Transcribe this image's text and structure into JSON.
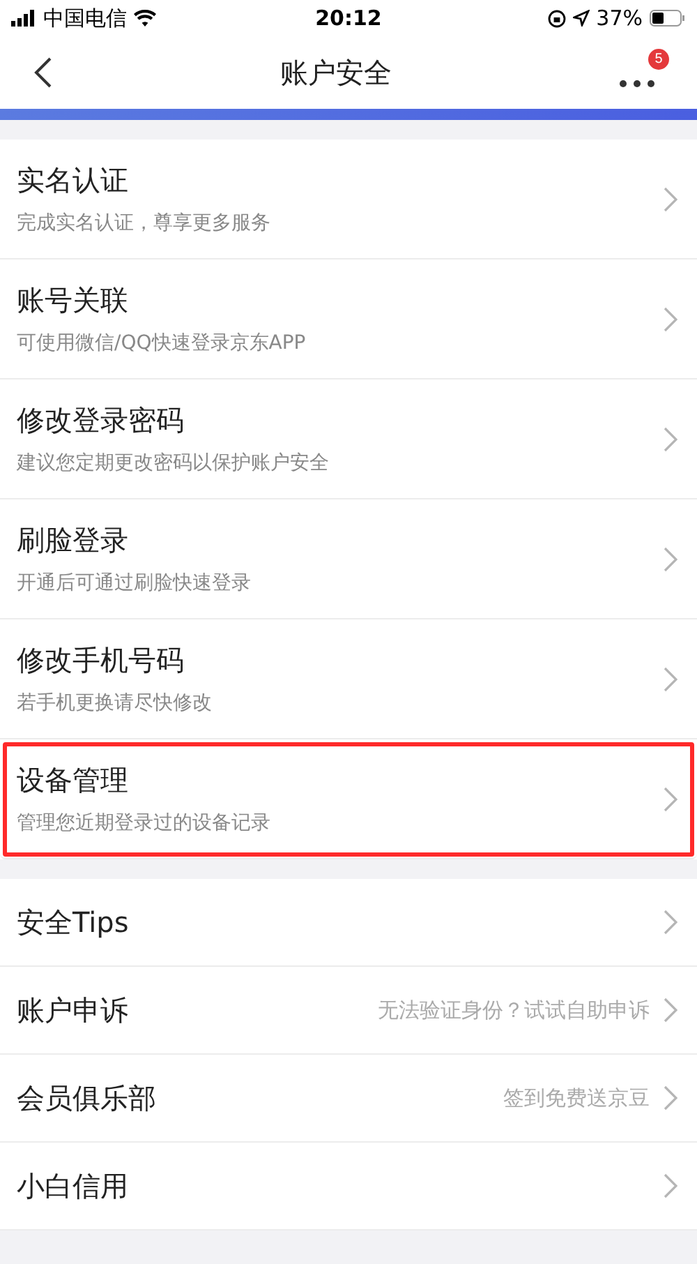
{
  "status_bar": {
    "carrier": "中国电信",
    "time": "20:12",
    "battery": "37%"
  },
  "nav": {
    "title": "账户安全",
    "badge": "5"
  },
  "groups": [
    {
      "items": [
        {
          "title": "实名认证",
          "subtitle": "完成实名认证，尊享更多服务",
          "highlighted": false
        },
        {
          "title": "账号关联",
          "subtitle": "可使用微信/QQ快速登录京东APP",
          "highlighted": false
        },
        {
          "title": "修改登录密码",
          "subtitle": "建议您定期更改密码以保护账户安全",
          "highlighted": false
        },
        {
          "title": "刷脸登录",
          "subtitle": "开通后可通过刷脸快速登录",
          "highlighted": false
        },
        {
          "title": "修改手机号码",
          "subtitle": "若手机更换请尽快修改",
          "highlighted": false
        },
        {
          "title": "设备管理",
          "subtitle": "管理您近期登录过的设备记录",
          "highlighted": true
        }
      ]
    },
    {
      "items": [
        {
          "title": "安全Tips",
          "highlighted": false
        },
        {
          "title": "账户申诉",
          "hint": "无法验证身份？试试自助申诉",
          "highlighted": false
        },
        {
          "title": "会员俱乐部",
          "hint": "签到免费送京豆",
          "highlighted": false
        },
        {
          "title": "小白信用",
          "highlighted": false
        }
      ]
    }
  ]
}
